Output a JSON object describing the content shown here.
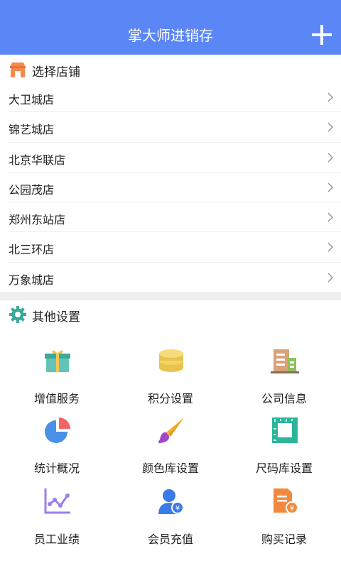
{
  "header": {
    "title": "掌大师进销存",
    "add_icon": "plus-icon"
  },
  "stores": {
    "title": "选择店铺",
    "icon": "store-icon",
    "items": [
      {
        "label": "大卫城店"
      },
      {
        "label": "锦艺城店"
      },
      {
        "label": "北京华联店"
      },
      {
        "label": "公园茂店"
      },
      {
        "label": "郑州东站店"
      },
      {
        "label": "北三环店"
      },
      {
        "label": "万象城店"
      }
    ]
  },
  "settings": {
    "title": "其他设置",
    "icon": "gear-icon",
    "items": [
      {
        "label": "增值服务",
        "icon": "gift-icon",
        "color": "#3cb4b4"
      },
      {
        "label": "积分设置",
        "icon": "coins-icon",
        "color": "#f0cc5a"
      },
      {
        "label": "公司信息",
        "icon": "building-icon",
        "color": "#c9956b"
      },
      {
        "label": "统计概况",
        "icon": "pie-chart-icon",
        "color": "#4a90e8"
      },
      {
        "label": "颜色库设置",
        "icon": "paint-brush-icon",
        "color": "#f6b02a"
      },
      {
        "label": "尺码库设置",
        "icon": "ruler-icon",
        "color": "#2db599"
      },
      {
        "label": "员工业绩",
        "icon": "line-chart-icon",
        "color": "#9b7ef0"
      },
      {
        "label": "会员充值",
        "icon": "member-recharge-icon",
        "color": "#3b7be8"
      },
      {
        "label": "购买记录",
        "icon": "purchase-record-icon",
        "color": "#f28a3d"
      }
    ]
  }
}
